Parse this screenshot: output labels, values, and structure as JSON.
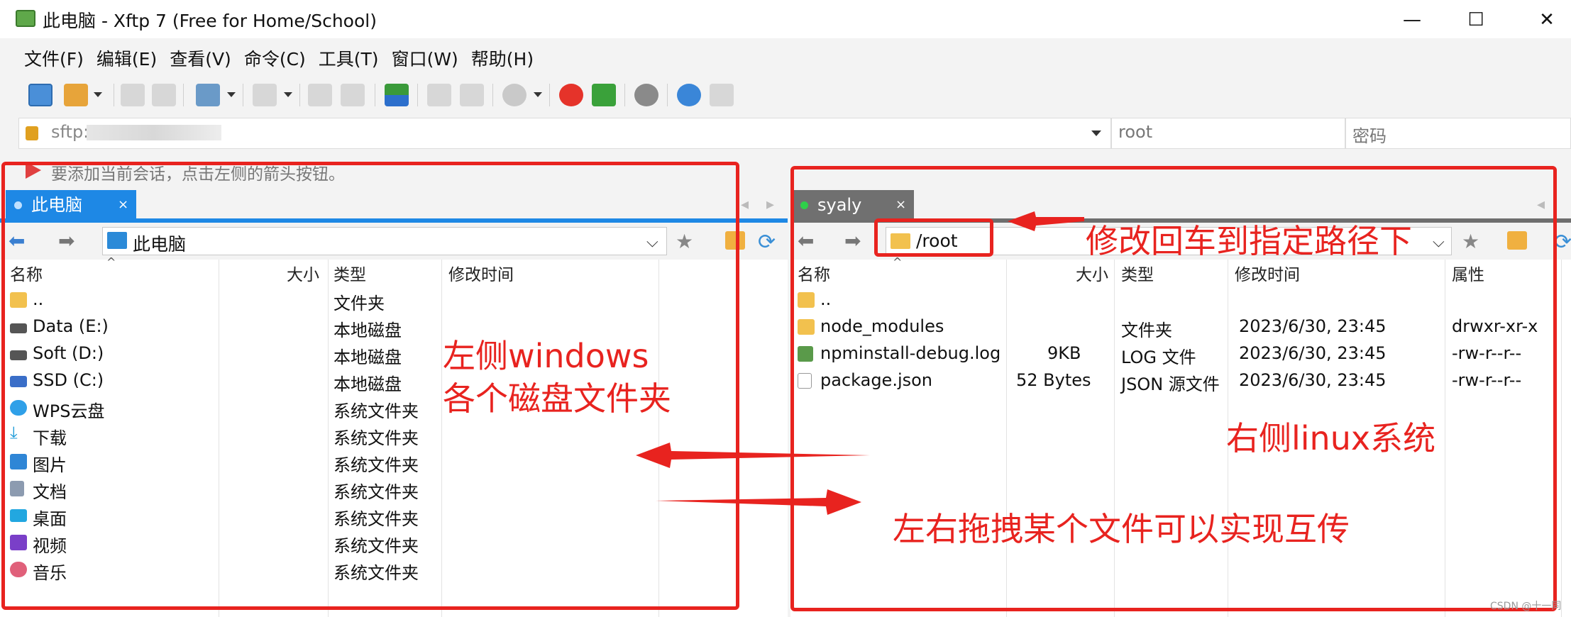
{
  "window": {
    "title": "此电脑 - Xftp 7 (Free for Home/School)",
    "minimize_glyph": "—",
    "maximize_glyph": "☐",
    "close_glyph": "✕"
  },
  "menu": [
    "文件(F)",
    "编辑(E)",
    "查看(V)",
    "命令(C)",
    "工具(T)",
    "窗口(W)",
    "帮助(H)"
  ],
  "address": {
    "url_text": "sftp:",
    "user_placeholder": "root",
    "password_placeholder": "密码"
  },
  "hint": "要添加当前会话，点击左侧的箭头按钮。",
  "left": {
    "tab_label": "此电脑",
    "tab_close": "×",
    "path": "此电脑",
    "columns": {
      "name": "名称",
      "size": "大小",
      "type": "类型",
      "modified": "修改时间"
    },
    "rows": [
      {
        "name": "..",
        "size": "",
        "type": "文件夹",
        "icon": "folder-icon"
      },
      {
        "name": "Data (E:)",
        "size": "",
        "type": "本地磁盘",
        "icon": "drive-icon"
      },
      {
        "name": "Soft (D:)",
        "size": "",
        "type": "本地磁盘",
        "icon": "drive-icon"
      },
      {
        "name": "SSD (C:)",
        "size": "",
        "type": "本地磁盘",
        "icon": "system-drive-icon"
      },
      {
        "name": "WPS云盘",
        "size": "",
        "type": "系统文件夹",
        "icon": "cloud-icon"
      },
      {
        "name": "下载",
        "size": "",
        "type": "系统文件夹",
        "icon": "download-icon"
      },
      {
        "name": "图片",
        "size": "",
        "type": "系统文件夹",
        "icon": "pictures-icon"
      },
      {
        "name": "文档",
        "size": "",
        "type": "系统文件夹",
        "icon": "documents-icon"
      },
      {
        "name": "桌面",
        "size": "",
        "type": "系统文件夹",
        "icon": "desktop-icon"
      },
      {
        "name": "视频",
        "size": "",
        "type": "系统文件夹",
        "icon": "videos-icon"
      },
      {
        "name": "音乐",
        "size": "",
        "type": "系统文件夹",
        "icon": "music-icon"
      }
    ]
  },
  "right": {
    "tab_label": "syaly",
    "tab_close": "×",
    "path": "/root",
    "columns": {
      "name": "名称",
      "size": "大小",
      "type": "类型",
      "modified": "修改时间",
      "attrs": "属性"
    },
    "rows": [
      {
        "name": "..",
        "size": "",
        "type": "",
        "modified": "",
        "attrs": "",
        "icon": "folder-icon"
      },
      {
        "name": "node_modules",
        "size": "",
        "type": "文件夹",
        "modified": "2023/6/30, 23:45",
        "attrs": "drwxr-xr-x",
        "icon": "folder-icon"
      },
      {
        "name": "npminstall-debug.log",
        "size": "9KB",
        "type": "LOG 文件",
        "modified": "2023/6/30, 23:45",
        "attrs": "-rw-r--r--",
        "icon": "log-file-icon"
      },
      {
        "name": "package.json",
        "size": "52 Bytes",
        "type": "JSON 源文件",
        "modified": "2023/6/30, 23:45",
        "attrs": "-rw-r--r--",
        "icon": "json-file-icon"
      }
    ]
  },
  "annotations": {
    "path_hint": "修改回车到指定路径下",
    "left_line1": "左侧windows",
    "left_line2": "各个磁盘文件夹",
    "right_label": "右侧linux系统",
    "drag_hint": "左右拖拽某个文件可以实现互传"
  },
  "watermark": "CSDN @十一同"
}
